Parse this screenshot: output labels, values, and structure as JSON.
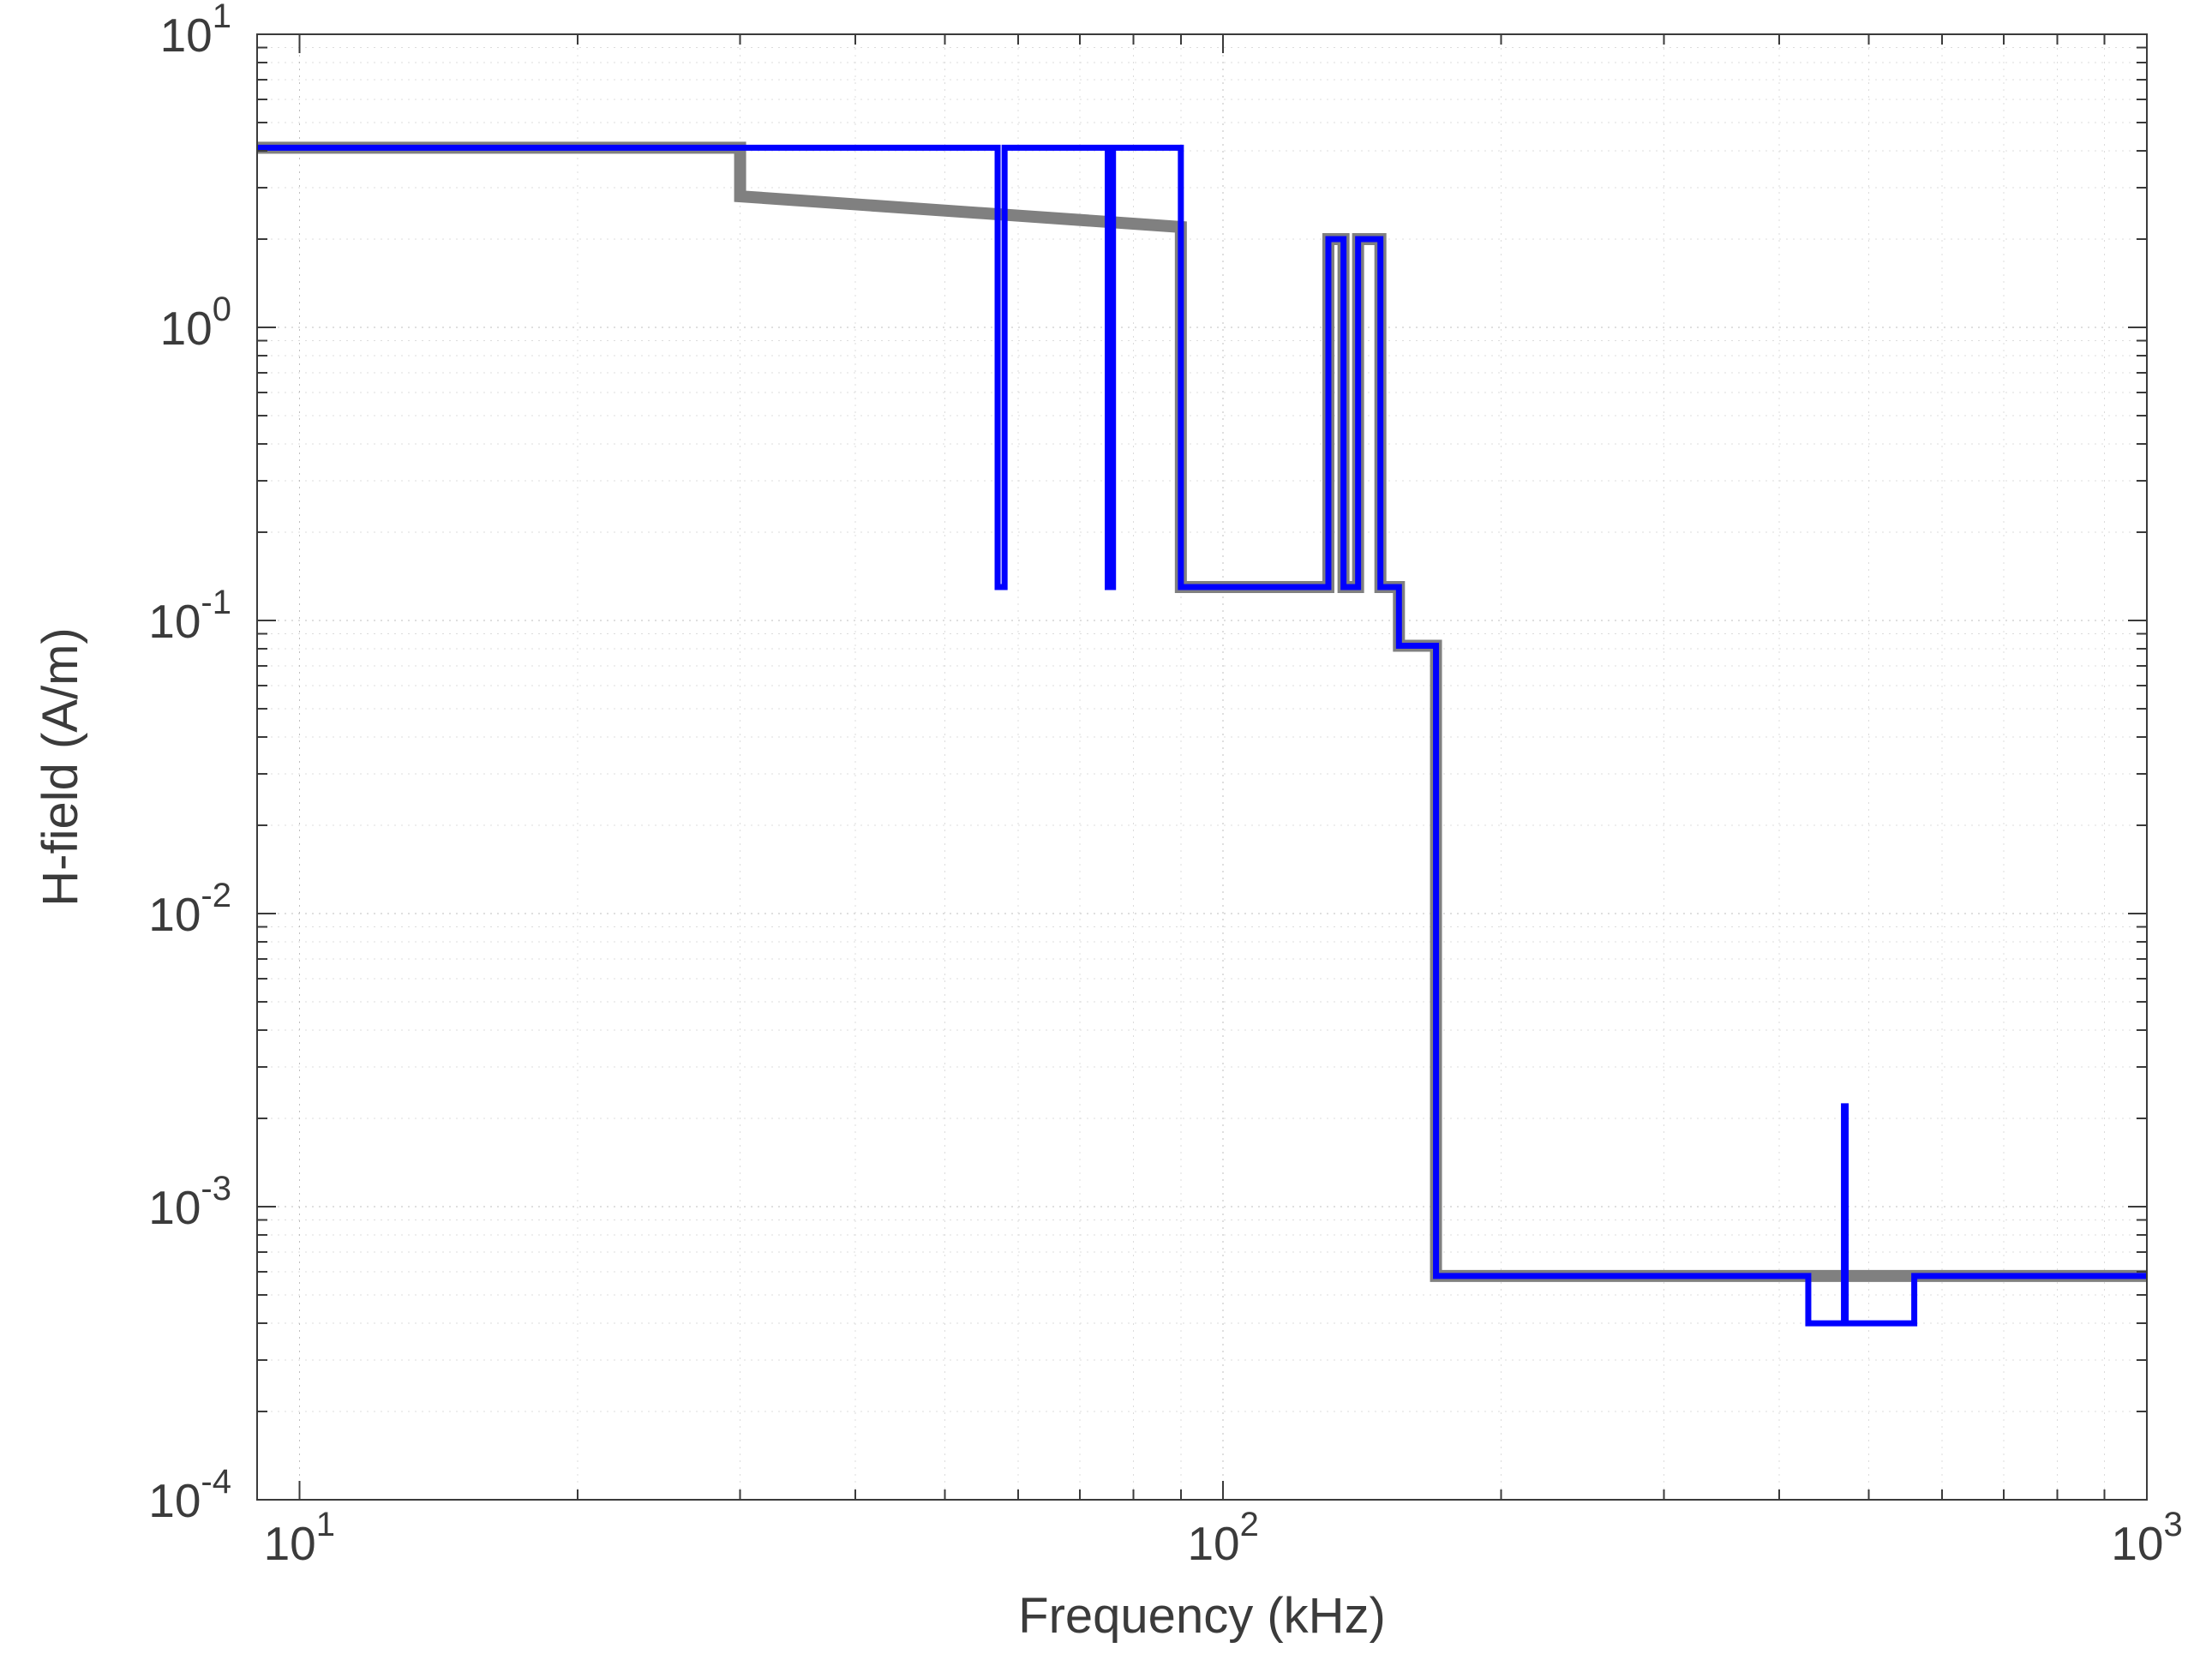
{
  "chart_data": {
    "type": "line",
    "scale": "log-log",
    "xlabel": "Frequency (kHz)",
    "ylabel": "H-field (A/m)",
    "xlim": [
      9,
      1000
    ],
    "ylim": [
      0.0001,
      10
    ],
    "x_decade_ticks": [
      10,
      100,
      1000
    ],
    "y_decade_ticks": [
      0.0001,
      0.001,
      0.01,
      0.1,
      1,
      10
    ],
    "x_tick_labels": [
      "10^1",
      "10^2",
      "10^3"
    ],
    "y_tick_labels": [
      "10^-4",
      "10^-3",
      "10^-2",
      "10^-1",
      "10^0",
      "10^1"
    ],
    "series": [
      {
        "name": "gray",
        "color": "#808080",
        "points": [
          [
            9,
            4.1
          ],
          [
            30,
            4.1
          ],
          [
            30,
            2.8
          ],
          [
            90,
            2.2
          ],
          [
            90,
            0.13
          ],
          [
            130,
            0.13
          ],
          [
            130,
            2.0
          ],
          [
            135,
            2.0
          ],
          [
            135,
            0.13
          ],
          [
            140,
            0.13
          ],
          [
            140,
            2.0
          ],
          [
            148,
            2.0
          ],
          [
            148,
            0.13
          ],
          [
            155,
            0.13
          ],
          [
            155,
            0.082
          ],
          [
            170,
            0.082
          ],
          [
            170,
            0.00058
          ],
          [
            1000,
            0.00058
          ]
        ]
      },
      {
        "name": "blue",
        "color": "#0000ff",
        "points": [
          [
            9,
            4.1
          ],
          [
            57,
            4.1
          ],
          [
            57,
            0.13
          ],
          [
            58,
            0.13
          ],
          [
            58,
            4.1
          ],
          [
            75,
            4.1
          ],
          [
            75,
            0.13
          ],
          [
            76,
            0.13
          ],
          [
            76,
            4.1
          ],
          [
            90,
            4.1
          ],
          [
            90,
            0.13
          ],
          [
            130,
            0.13
          ],
          [
            130,
            2.0
          ],
          [
            135,
            2.0
          ],
          [
            135,
            0.13
          ],
          [
            140,
            0.13
          ],
          [
            140,
            2.0
          ],
          [
            148,
            2.0
          ],
          [
            148,
            0.13
          ],
          [
            155,
            0.13
          ],
          [
            155,
            0.082
          ],
          [
            170,
            0.082
          ],
          [
            170,
            0.00058
          ],
          [
            430,
            0.00058
          ],
          [
            430,
            0.0004
          ],
          [
            470,
            0.0004
          ],
          [
            470,
            0.0022
          ],
          [
            472,
            0.0022
          ],
          [
            472,
            0.0004
          ],
          [
            560,
            0.0004
          ],
          [
            560,
            0.00058
          ],
          [
            1000,
            0.00058
          ]
        ]
      }
    ]
  },
  "labels": {
    "xlabel": "Frequency (kHz)",
    "ylabel": "H-field (A/m)"
  }
}
